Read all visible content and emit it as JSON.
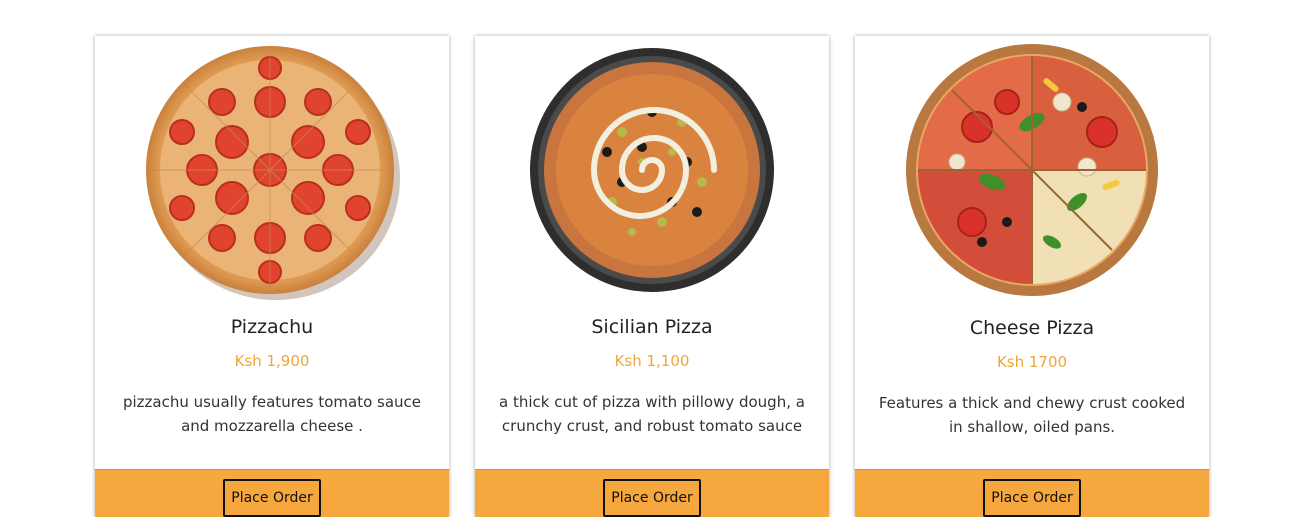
{
  "cards": [
    {
      "title": "Pizzachu",
      "price": "Ksh 1,900",
      "description": "pizzachu usually features tomato sauce and mozzarella cheese .",
      "button_label": "Place Order",
      "image_icon": "pepperoni-pizza-image"
    },
    {
      "title": "Sicilian Pizza",
      "price": "Ksh 1,100",
      "description": "a thick cut of pizza with pillowy dough, a crunchy crust, and robust tomato sauce",
      "button_label": "Place Order",
      "image_icon": "sicilian-pizza-image"
    },
    {
      "title": "Cheese Pizza",
      "price": "Ksh 1700",
      "description": "Features a thick and chewy crust cooked in shallow, oiled pans.",
      "button_label": "Place Order",
      "image_icon": "mixed-topping-pizza-image"
    }
  ],
  "colors": {
    "accent": "#f6a73d",
    "price": "#f0a53a",
    "title": "#222222"
  }
}
